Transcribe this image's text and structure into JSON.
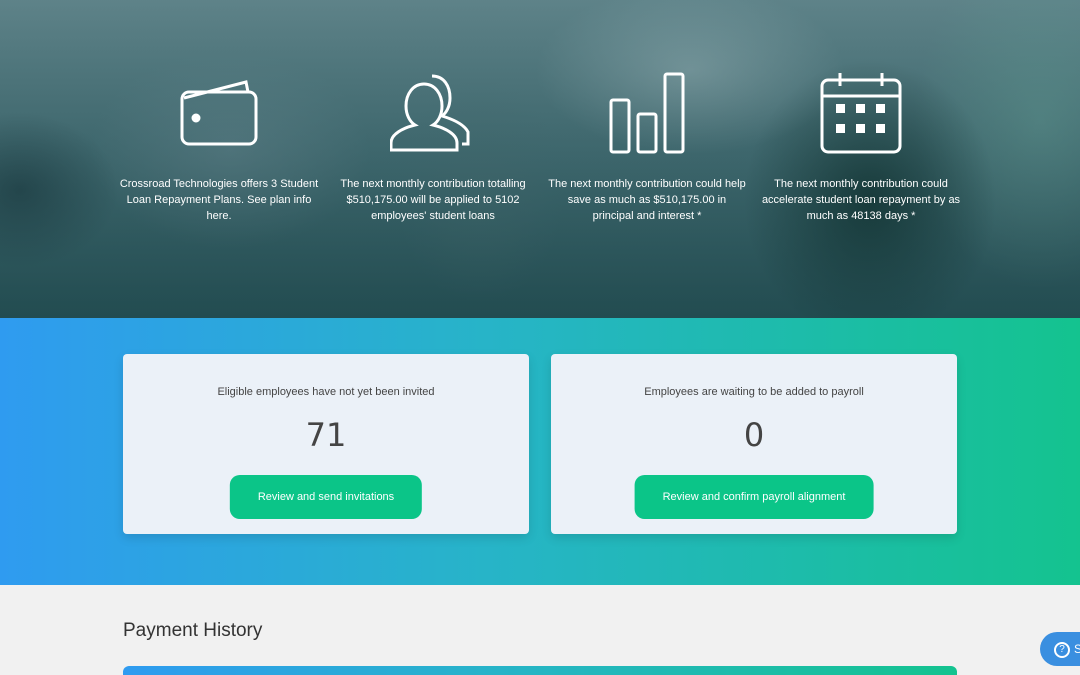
{
  "features": [
    {
      "icon": "wallet-icon",
      "text": "Crossroad Technologies offers 3 Student Loan Repayment Plans. See plan info here."
    },
    {
      "icon": "users-icon",
      "text": "The next monthly contribution totalling $510,175.00 will be applied to 5102 employees' student loans"
    },
    {
      "icon": "bar-chart-icon",
      "text": "The next monthly contribution could help save as much as $510,175.00 in principal and interest *"
    },
    {
      "icon": "calendar-icon",
      "text": "The next monthly contribution could accelerate student loan repayment by as much as 48138 days *"
    }
  ],
  "cards": [
    {
      "label": "Eligible employees have not yet been invited",
      "count": "71",
      "button": "Review and send invitations"
    },
    {
      "label": "Employees are waiting to be added to payroll",
      "count": "0",
      "button": "Review and confirm payroll alignment"
    }
  ],
  "history": {
    "title": "Payment History"
  },
  "help": {
    "label": "S"
  },
  "colors": {
    "accent_green": "#0bc588",
    "gradient_start": "#2f9bf0",
    "gradient_end": "#14c38f"
  }
}
